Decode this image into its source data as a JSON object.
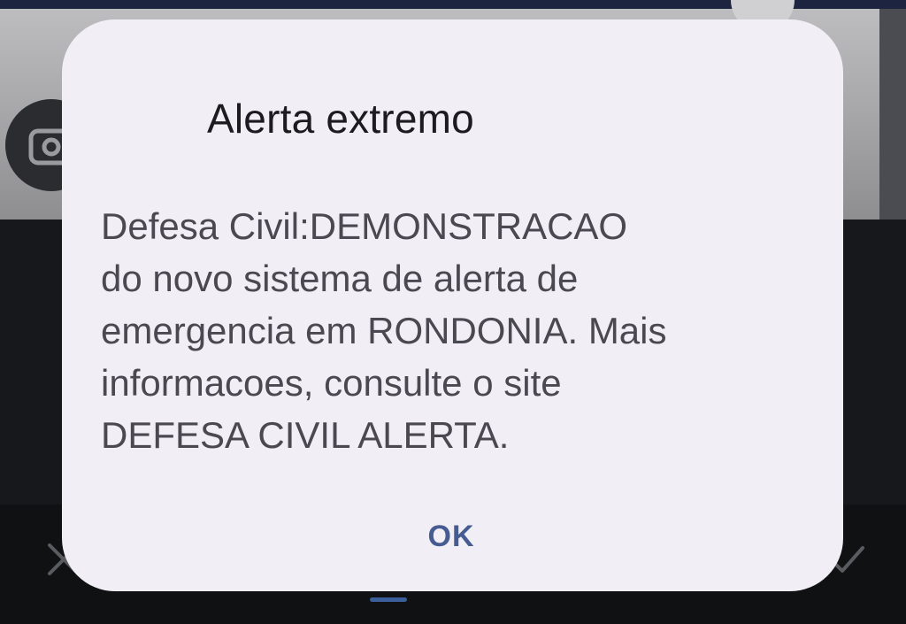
{
  "background": {
    "topbar_color": "#1d2440",
    "icons": [
      "camera-switch-icon",
      "close-icon",
      "checkmark-icon"
    ]
  },
  "dialog": {
    "title": "Alerta extremo",
    "message": "Defesa Civil:DEMONSTRACAO\ndo novo sistema de alerta de\nemergencia em RONDONIA. Mais\ninformacoes, consulte o site\nDEFESA CIVIL ALERTA.",
    "ok_label": "OK",
    "background_color": "#f1eef5",
    "accent_color": "#465b91"
  }
}
